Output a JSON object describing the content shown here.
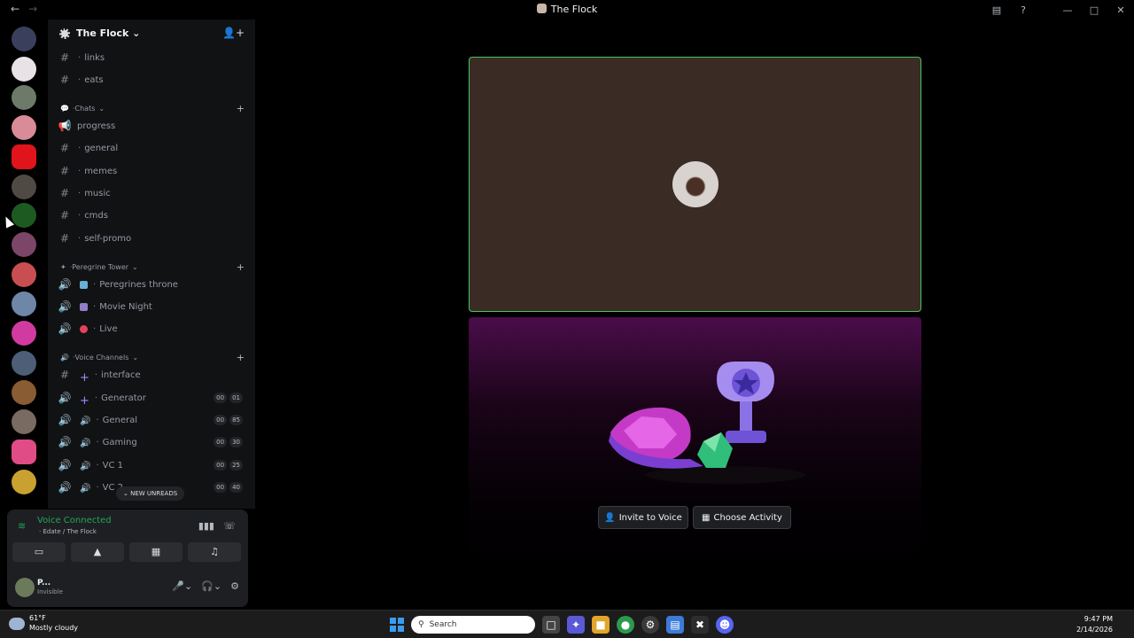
{
  "window": {
    "title": "The Flock",
    "back_icon": "arrow-left-icon",
    "forward_icon": "arrow-right-icon",
    "controls": [
      "inbox-icon",
      "help-icon",
      "minimize-icon",
      "maximize-icon",
      "close-icon"
    ]
  },
  "server": {
    "name": "The Flock"
  },
  "channels_top": [
    {
      "type": "text",
      "name": "links"
    },
    {
      "type": "text",
      "name": "eats"
    }
  ],
  "categories": [
    {
      "name": "Chats",
      "channels": [
        {
          "type": "announcement",
          "name": "progress"
        },
        {
          "type": "text",
          "name": "general"
        },
        {
          "type": "text",
          "name": "memes"
        },
        {
          "type": "text",
          "name": "music"
        },
        {
          "type": "text",
          "name": "cmds"
        },
        {
          "type": "text",
          "name": "self-promo"
        }
      ]
    },
    {
      "name": "Peregrine Tower",
      "channels": [
        {
          "type": "voice",
          "name": "Peregrines throne"
        },
        {
          "type": "voice",
          "name": "Movie Night"
        },
        {
          "type": "voice",
          "name": "Live"
        }
      ]
    },
    {
      "name": "Voice Channels",
      "channels": [
        {
          "type": "text",
          "name": "interface"
        },
        {
          "type": "voice",
          "name": "Generator",
          "badge": [
            "00",
            "01"
          ]
        },
        {
          "type": "voice",
          "name": "General",
          "badge": [
            "00",
            "85"
          ]
        },
        {
          "type": "voice",
          "name": "Gaming",
          "badge": [
            "00",
            "30"
          ]
        },
        {
          "type": "voice",
          "name": "VC 1",
          "badge": [
            "00",
            "25"
          ]
        },
        {
          "type": "voice",
          "name": "VC 2",
          "badge": [
            "00",
            "40"
          ]
        }
      ]
    }
  ],
  "new_unreads": "NEW UNREADS",
  "voice_panel": {
    "status": "Voice Connected",
    "location": "Edate / The Flock"
  },
  "user": {
    "name": "P...",
    "status": "Invisible"
  },
  "call": {
    "invite_label": "Invite to Voice",
    "activity_label": "Choose Activity"
  },
  "taskbar": {
    "temperature": "61°F",
    "condition": "Mostly cloudy",
    "search_placeholder": "Search",
    "time": "9:47 PM",
    "date": "2/14/2026"
  },
  "colors": {
    "voice_green": "#23a55a",
    "tile_border": "#4cc25f",
    "tile_bg": "#3a2b25"
  }
}
